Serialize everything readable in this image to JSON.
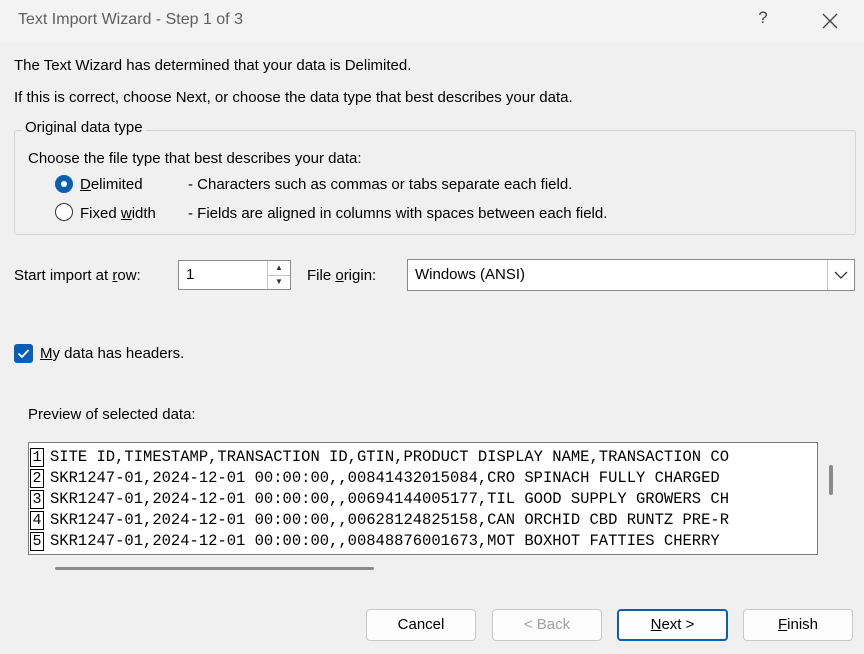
{
  "window": {
    "title": "Text Import Wizard - Step 1 of 3",
    "help": "?"
  },
  "intro": {
    "line1": "The Text Wizard has determined that your data is Delimited.",
    "line2": "If this is correct, choose Next, or choose the data type that best describes your data."
  },
  "original_type": {
    "group_title": "Original data type",
    "prompt": "Choose the file type that best describes your data:",
    "options": [
      {
        "label_pre": "",
        "label_key": "D",
        "label_post": "elimited",
        "desc": "- Characters such as commas or tabs separate each field.",
        "selected": true
      },
      {
        "label_pre": "Fixed ",
        "label_key": "w",
        "label_post": "idth",
        "desc": "- Fields are aligned in columns with spaces between each field.",
        "selected": false
      }
    ]
  },
  "start_row": {
    "label_pre": "Start import at ",
    "label_key": "r",
    "label_post": "ow:",
    "value": "1"
  },
  "file_origin": {
    "label_pre": "File ",
    "label_key": "o",
    "label_post": "rigin:",
    "value": "Windows (ANSI)"
  },
  "headers": {
    "label_key": "M",
    "label_post": "y data has headers.",
    "checked": true
  },
  "preview": {
    "label": "Preview of selected data:",
    "rows": [
      {
        "num": "1",
        "text": "SITE ID,TIMESTAMP,TRANSACTION ID,GTIN,PRODUCT DISPLAY NAME,TRANSACTION CO"
      },
      {
        "num": "2",
        "text": "SKR1247-01,2024-12-01 00:00:00,,00841432015084,CRO SPINACH FULLY CHARGED"
      },
      {
        "num": "3",
        "text": "SKR1247-01,2024-12-01 00:00:00,,00694144005177,TIL GOOD SUPPLY GROWERS CH"
      },
      {
        "num": "4",
        "text": "SKR1247-01,2024-12-01 00:00:00,,00628124825158,CAN ORCHID CBD RUNTZ PRE-R"
      },
      {
        "num": "5",
        "text": "SKR1247-01,2024-12-01 00:00:00,,00848876001673,MOT BOXHOT FATTIES CHERRY"
      }
    ]
  },
  "buttons": {
    "cancel": "Cancel",
    "back": "< Back",
    "next_key": "N",
    "next_post": "ext >",
    "finish_key": "F",
    "finish_post": "inish"
  },
  "colors": {
    "accent": "#0a5fb4",
    "background": "#f0f0f0"
  }
}
